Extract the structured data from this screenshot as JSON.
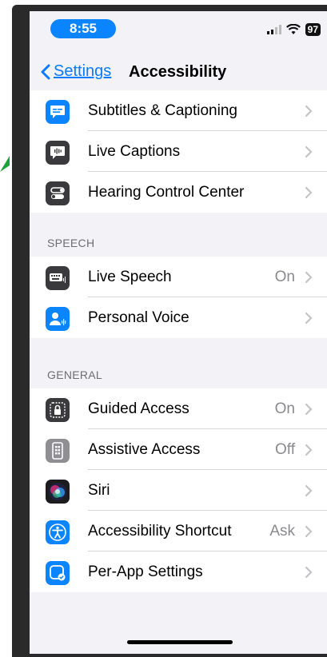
{
  "status_bar": {
    "time": "8:55",
    "battery": "97",
    "icons": [
      "signal-icon",
      "wifi-icon",
      "battery-icon"
    ]
  },
  "nav": {
    "back_label": "Settings",
    "title": "Accessibility"
  },
  "groups": [
    {
      "header": "",
      "items": [
        {
          "label": "Subtitles & Captioning",
          "value": "",
          "icon": "subtitles-icon",
          "color": "#0a84ff"
        },
        {
          "label": "Live Captions",
          "value": "",
          "icon": "live-captions-icon",
          "color": "#3a3a3c"
        },
        {
          "label": "Hearing Control Center",
          "value": "",
          "icon": "toggle-switches-icon",
          "color": "#3a3a3c"
        }
      ]
    },
    {
      "header": "SPEECH",
      "items": [
        {
          "label": "Live Speech",
          "value": "On",
          "icon": "keyboard-icon",
          "color": "#3a3a3c"
        },
        {
          "label": "Personal Voice",
          "value": "",
          "icon": "person-voice-icon",
          "color": "#0a84ff"
        }
      ]
    },
    {
      "header": "GENERAL",
      "items": [
        {
          "label": "Guided Access",
          "value": "On",
          "icon": "lock-icon",
          "color": "#3a3a3c"
        },
        {
          "label": "Assistive Access",
          "value": "Off",
          "icon": "phone-grid-icon",
          "color": "#8e8e93"
        },
        {
          "label": "Siri",
          "value": "",
          "icon": "siri-icon",
          "color": "#1c1c1e"
        },
        {
          "label": "Accessibility Shortcut",
          "value": "Ask",
          "icon": "accessibility-icon",
          "color": "#0a84ff"
        },
        {
          "label": "Per-App Settings",
          "value": "",
          "icon": "app-check-icon",
          "color": "#0a84ff"
        }
      ]
    }
  ]
}
